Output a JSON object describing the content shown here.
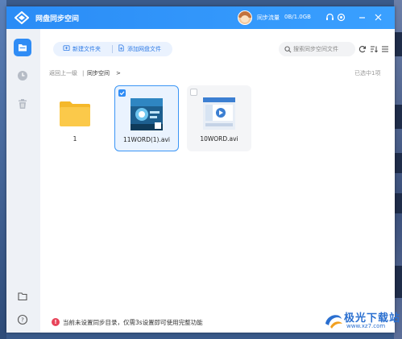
{
  "app": {
    "title": "网盘同步空间",
    "sync_label": "同步流量",
    "sync_value": "0B/1.0GB"
  },
  "titlebar_icons": [
    "headset-icon",
    "settings-icon",
    "minimize-icon",
    "close-icon"
  ],
  "sidebar": {
    "items": [
      {
        "name": "sync-folder",
        "active": true
      },
      {
        "name": "history",
        "active": false
      },
      {
        "name": "trash",
        "active": false
      }
    ],
    "bottom_items": [
      "folder",
      "help"
    ]
  },
  "toolbar": {
    "new_folder_label": "新建文件夹",
    "add_file_label": "添加网盘文件"
  },
  "search": {
    "placeholder": "搜索同步空间文件"
  },
  "breadcrumb": {
    "back_label": "返回上一级",
    "current": "同步空间",
    "selected_count": "已选中1项"
  },
  "files": [
    {
      "name": "1",
      "type": "folder",
      "selected": false
    },
    {
      "name": "11WORD(1).avi",
      "type": "video",
      "selected": true
    },
    {
      "name": "10WORD.avi",
      "type": "video",
      "selected": false
    }
  ],
  "footer": {
    "message": "当前未设置同步目录，仅需3s设置即可使用完整功能"
  },
  "watermark": {
    "brand": "极光下载站",
    "url": "www.xz7.com"
  },
  "colors": {
    "accent": "#2f8cf5",
    "titlebar": "#3aa0ff",
    "warning": "#e8445a"
  }
}
